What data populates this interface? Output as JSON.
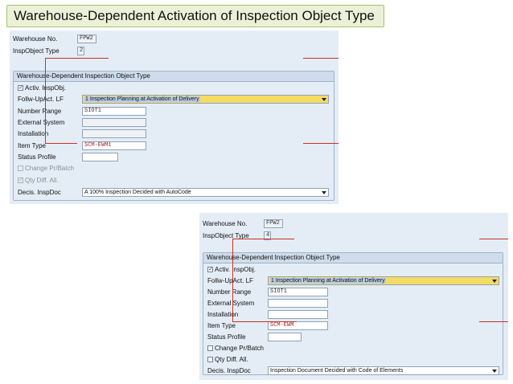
{
  "slide": {
    "title": "Warehouse-Dependent Activation of Inspection Object Type"
  },
  "colors": {
    "panel_bg": "#e4edf6",
    "highlight": "#f4db62",
    "annotation_line": "#c9302c",
    "title_bg": "#ebf1d7"
  },
  "screen1": {
    "warehouse_label": "Warehouse No.",
    "warehouse_value": "FPW2",
    "insp_object_label": "InspObject Type",
    "insp_object_value": "2",
    "group_title": "Warehouse-Dependent Inspection Object Type",
    "activ_label": "Activ. InspObj.",
    "activ_checked": true,
    "followup_label": "Follw-UpAct. LF",
    "followup_value": "1 Inspection Planning at Activation of Delivery",
    "number_range_label": "Number Range",
    "number_range_value": "SIOT1",
    "external_system_label": "External System",
    "external_system_value": "",
    "installation_label": "Installation",
    "installation_value": "",
    "item_type_label": "Item Type",
    "item_type_value": "SCM-EWM1",
    "status_profile_label": "Status Profile",
    "status_profile_value": "",
    "change_pr_label": "Change Pr/Batch",
    "change_pr_checked": false,
    "qty_diff_label": "Qty Diff. All.",
    "qty_diff_checked": true,
    "decis_label": "Decis. InspDoc",
    "decis_value": "A 100% Inspection Decided with AutoCode"
  },
  "screen2": {
    "warehouse_label": "Warehouse No.",
    "warehouse_value": "FPW2",
    "insp_object_label": "InspObject Type",
    "insp_object_value": "4",
    "group_title": "Warehouse-Dependent Inspection Object Type",
    "activ_label": "Activ. InspObj.",
    "activ_checked": true,
    "followup_label": "Follw-UpAct. LF",
    "followup_value": "1 Inspection Planning at Activation of Delivery",
    "number_range_label": "Number Range",
    "number_range_value": "SIOT1",
    "external_system_label": "External System",
    "external_system_value": "",
    "installation_label": "Installation",
    "installation_value": "",
    "item_type_label": "Item Type",
    "item_type_value": "SCM-EWM",
    "status_profile_label": "Status Profile",
    "status_profile_value": "",
    "change_pr_label": "Change Pr/Batch",
    "change_pr_checked": false,
    "qty_diff_label": "Qty Diff. All.",
    "qty_diff_checked": false,
    "decis_label": "Decis. InspDoc",
    "decis_value": "Inspection Document Decided with Code of Elements"
  }
}
